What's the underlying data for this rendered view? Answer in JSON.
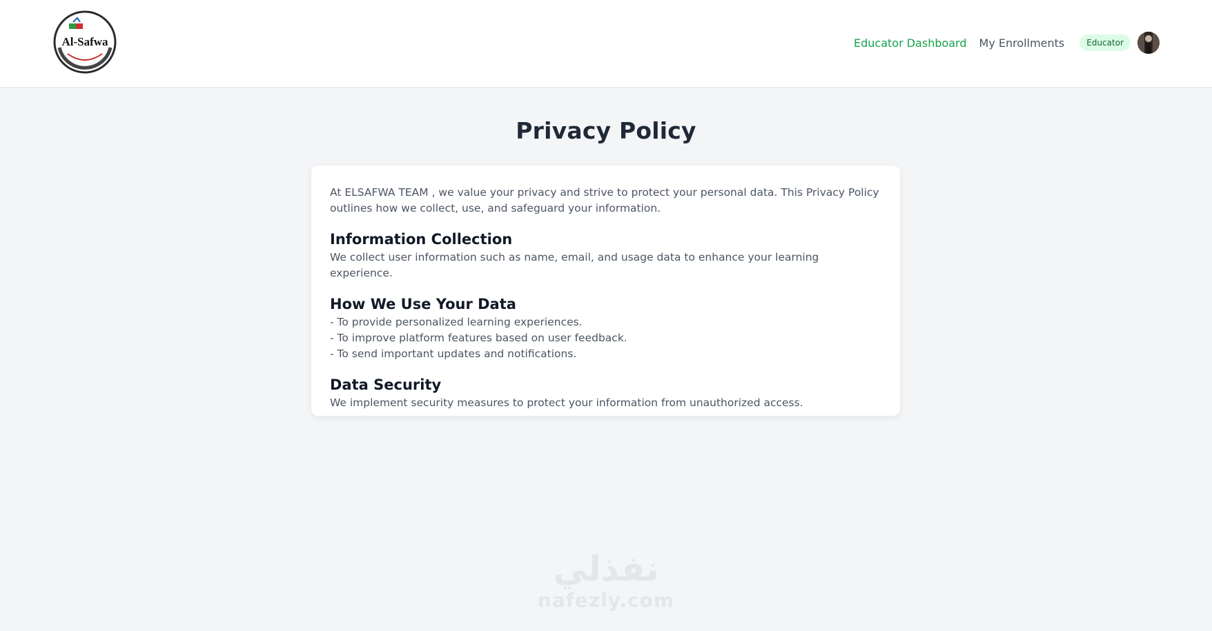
{
  "header": {
    "logo_text": "Al-Safwa",
    "nav": [
      {
        "label": "Educator Dashboard",
        "active": true
      },
      {
        "label": "My Enrollments",
        "active": false
      }
    ],
    "role_badge": "Educator"
  },
  "page": {
    "title": "Privacy Policy",
    "intro": "At ELSAFWA TEAM , we value your privacy and strive to protect your personal data. This Privacy Policy outlines how we collect, use, and safeguard your information.",
    "sections": [
      {
        "heading": "Information Collection",
        "lines": [
          "We collect user information such as name, email, and usage data to enhance your learning experience."
        ]
      },
      {
        "heading": "How We Use Your Data",
        "lines": [
          "- To provide personalized learning experiences.",
          "- To improve platform features based on user feedback.",
          "- To send important updates and notifications."
        ]
      },
      {
        "heading": "Data Security",
        "lines": [
          "We implement security measures to protect your information from unauthorized access."
        ]
      }
    ]
  },
  "watermark": {
    "arabic": "نفذلي",
    "latin": "nafezly.com"
  },
  "colors": {
    "accent": "#16a34a",
    "badge_bg": "#dcfce7",
    "page_bg": "#f4f5f7"
  }
}
